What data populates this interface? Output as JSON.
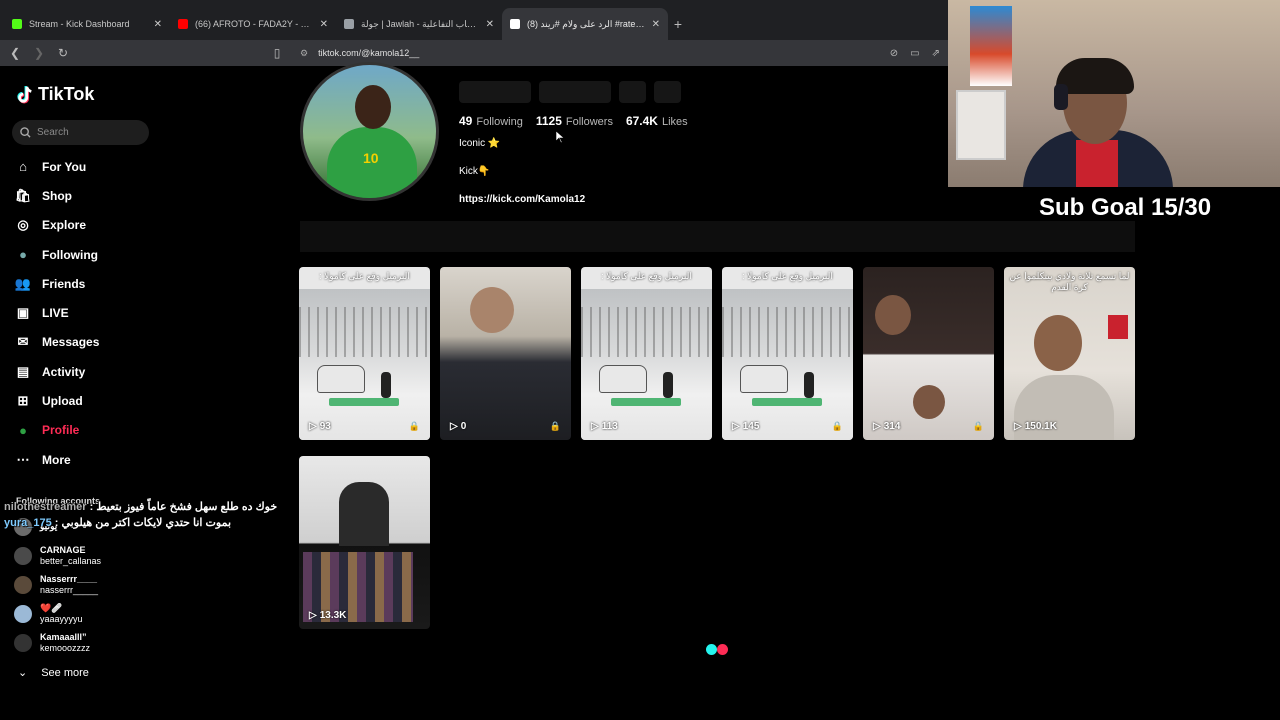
{
  "browser": {
    "tabs": [
      {
        "title": "Stream - Kick Dashboard",
        "favicon_color": "#53fc18",
        "active": false
      },
      {
        "title": "(66) AFROTO - FADA2Y - YouTube",
        "favicon_color": "#ff0000",
        "active": false
      },
      {
        "title": "جولة | Jawlah - منصة الألعاب التفاعلية",
        "favicon_color": "#9aa0a6",
        "active": false
      },
      {
        "title": "(8) الرد على ولام #ريند #ratedv1",
        "favicon_color": "#ffffff",
        "active": true
      }
    ],
    "url": "tiktok.com/@kamola12__"
  },
  "tiktok": {
    "logo": "TikTok",
    "search_placeholder": "Search",
    "nav": [
      {
        "label": "For You",
        "icon": "home-icon"
      },
      {
        "label": "Shop",
        "icon": "shop-icon"
      },
      {
        "label": "Explore",
        "icon": "compass-icon"
      },
      {
        "label": "Following",
        "icon": "following-avatar-icon"
      },
      {
        "label": "Friends",
        "icon": "friends-icon"
      },
      {
        "label": "LIVE",
        "icon": "live-icon"
      },
      {
        "label": "Messages",
        "icon": "messages-icon"
      },
      {
        "label": "Activity",
        "icon": "activity-icon"
      },
      {
        "label": "Upload",
        "icon": "upload-icon"
      },
      {
        "label": "Profile",
        "icon": "profile-avatar-icon",
        "active": true
      },
      {
        "label": "More",
        "icon": "more-icon"
      }
    ],
    "following_title": "Following accounts",
    "following_accounts": [
      {
        "name": "يوليو",
        "handle": "",
        "color": "#6b6b6b"
      },
      {
        "name": "CARNAGE",
        "handle": "better_callanas",
        "color": "#4a4a4a"
      },
      {
        "name": "Nasserrr____",
        "handle": "nasserrr_____",
        "color": "#5a4a3a"
      },
      {
        "name": "❤️🩹",
        "handle": "yaaayyyyu",
        "color": "#9bb9d6"
      },
      {
        "name": "Kamaaalll”",
        "handle": "kemooozzzz",
        "color": "#333333"
      }
    ],
    "see_more": "See more"
  },
  "chat": [
    {
      "user": "nilothestreamer",
      "message": "خوك ده طلع سهل فشخ عاماً فيوز بتعيط"
    },
    {
      "user": "yura_175",
      "message": "بموت انا حتدي لايكات اكتر من هيلوبي"
    }
  ],
  "profile": {
    "stats": [
      {
        "value": "49",
        "label": "Following"
      },
      {
        "value": "1125",
        "label": "Followers"
      },
      {
        "value": "67.4K",
        "label": "Likes"
      }
    ],
    "bio_line1": "Iconic ⭐",
    "bio_line2": "Kick👇",
    "link": "https://kick.com/Kamola12"
  },
  "videos": [
    {
      "views": "93",
      "caption": "البرميل وقع على كامولا :",
      "style": "snow",
      "locked": true
    },
    {
      "views": "0",
      "caption": "",
      "style": "person",
      "locked": true
    },
    {
      "views": "113",
      "caption": "البرميل وقع على كامولا :",
      "style": "snow",
      "locked": false
    },
    {
      "views": "145",
      "caption": "البرميل وقع على كامولا :",
      "style": "snow",
      "locked": true
    },
    {
      "views": "314",
      "caption": "",
      "style": "stream",
      "locked": true
    },
    {
      "views": "150.1K",
      "caption": "لما تسمع تلاتة ولادي بيتكلموا عن كرة القدم",
      "style": "talk",
      "locked": false
    },
    {
      "views": "13.3K",
      "caption": "",
      "style": "grid",
      "locked": false
    }
  ],
  "stream_overlay": {
    "sub_goal": "Sub Goal 15/30"
  },
  "colors": {
    "accent": "#fe2c55",
    "cyan": "#25f4ee",
    "kick_green": "#53fc18"
  }
}
